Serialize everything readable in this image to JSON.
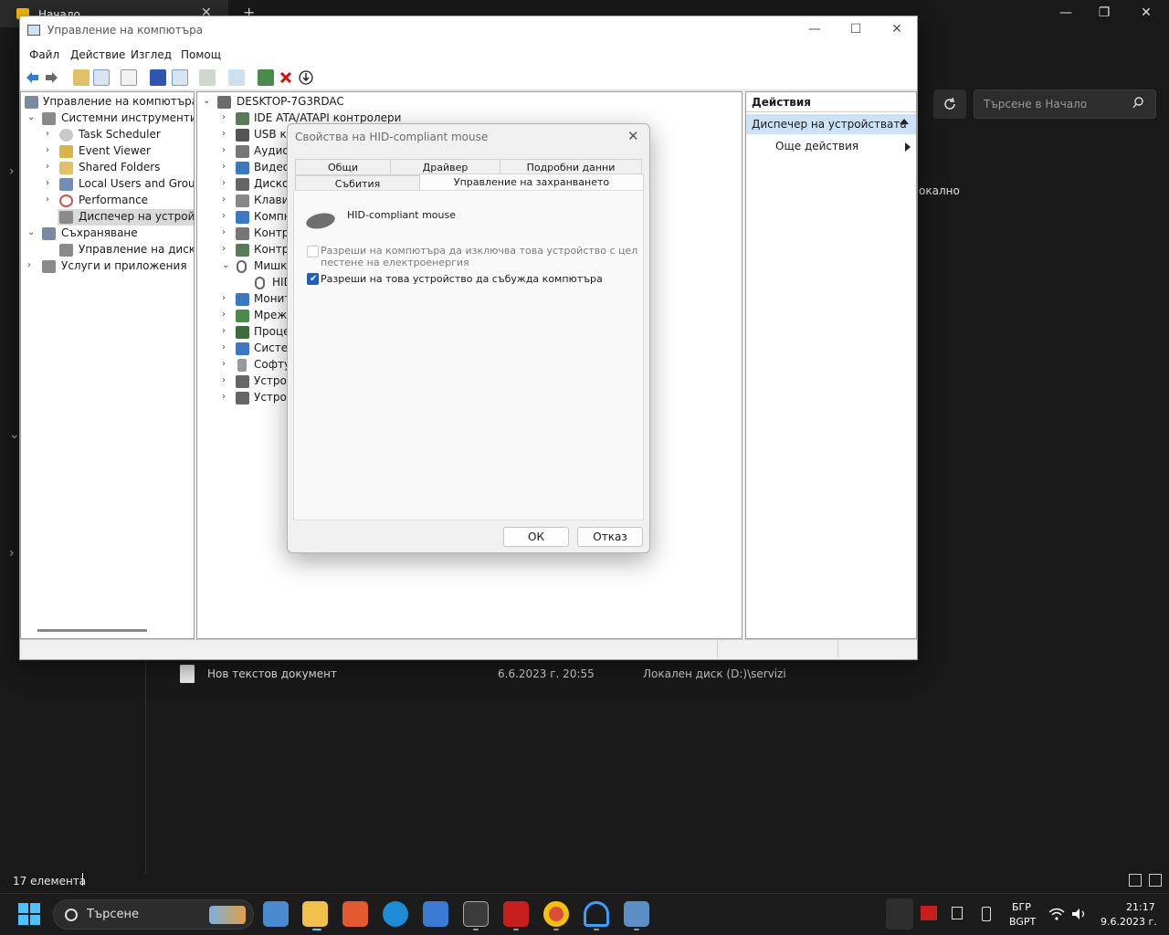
{
  "explorer": {
    "tab_label": "Начало",
    "search_placeholder": "Търсене в Начало",
    "partial_text": "окално",
    "file": {
      "name": "Нов текстов документ",
      "date": "6.6.2023 г. 20:55",
      "path": "Локален диск (D:)\\servizi"
    },
    "status": "17 елемента"
  },
  "cm": {
    "title": "Управление на компютъра",
    "menu": [
      "Файл",
      "Действие",
      "Изглед",
      "Помощ"
    ],
    "left_tree": [
      {
        "label": "Управление на компютъра (л",
        "arrow": "",
        "indent": 0,
        "icon_color": "#7a8aa0"
      },
      {
        "label": "Системни инструменти",
        "arrow": "⌄",
        "indent": 1,
        "icon_color": "#8a8a8a"
      },
      {
        "label": "Task Scheduler",
        "arrow": "›",
        "indent": 2,
        "icon_color": "#c9c9c9"
      },
      {
        "label": "Event Viewer",
        "arrow": "›",
        "indent": 2,
        "icon_color": "#d9b24a"
      },
      {
        "label": "Shared Folders",
        "arrow": "›",
        "indent": 2,
        "icon_color": "#e3c067"
      },
      {
        "label": "Local Users and Groups",
        "arrow": "›",
        "indent": 2,
        "icon_color": "#6f8fb8"
      },
      {
        "label": "Performance",
        "arrow": "›",
        "indent": 2,
        "icon_color": "#d35050"
      },
      {
        "label": "Диспечер на устройства",
        "arrow": "",
        "indent": 2,
        "icon_color": "#8a8a8a",
        "selected": true
      },
      {
        "label": "Съхраняване",
        "arrow": "⌄",
        "indent": 1,
        "icon_color": "#7a8aa0"
      },
      {
        "label": "Управление на дискове",
        "arrow": "",
        "indent": 2,
        "icon_color": "#8a8a8a"
      },
      {
        "label": "Услуги и приложения",
        "arrow": "›",
        "indent": 1,
        "icon_color": "#8a8a8a"
      }
    ],
    "mid_tree": [
      {
        "label": "DESKTOP-7G3RDAC",
        "arrow": "⌄",
        "indent": 0,
        "icon_color": "#6c6c6c"
      },
      {
        "label": "IDE ATA/ATAPI контролери",
        "arrow": "›",
        "indent": 1,
        "icon_color": "#5a7a5a"
      },
      {
        "label": "USB ко",
        "arrow": "›",
        "indent": 1,
        "icon_color": "#555"
      },
      {
        "label": "Аудио",
        "arrow": "›",
        "indent": 1,
        "icon_color": "#777"
      },
      {
        "label": "Видео",
        "arrow": "›",
        "indent": 1,
        "icon_color": "#3b78c4"
      },
      {
        "label": "Диско",
        "arrow": "›",
        "indent": 1,
        "icon_color": "#666"
      },
      {
        "label": "Клави",
        "arrow": "›",
        "indent": 1,
        "icon_color": "#888"
      },
      {
        "label": "Компю",
        "arrow": "›",
        "indent": 1,
        "icon_color": "#3b78c4"
      },
      {
        "label": "Контро",
        "arrow": "›",
        "indent": 1,
        "icon_color": "#777"
      },
      {
        "label": "Контро",
        "arrow": "›",
        "indent": 1,
        "icon_color": "#5a7a5a"
      },
      {
        "label": "Мишк",
        "arrow": "⌄",
        "indent": 1,
        "icon_color": "#666"
      },
      {
        "label": "HID",
        "arrow": "",
        "indent": 2,
        "icon_color": "#666"
      },
      {
        "label": "Монит",
        "arrow": "›",
        "indent": 1,
        "icon_color": "#3b78c4"
      },
      {
        "label": "Мреж",
        "arrow": "›",
        "indent": 1,
        "icon_color": "#4a8a4a"
      },
      {
        "label": "Проце",
        "arrow": "›",
        "indent": 1,
        "icon_color": "#3c6c3c"
      },
      {
        "label": "Систем",
        "arrow": "›",
        "indent": 1,
        "icon_color": "#3b78c4"
      },
      {
        "label": "Софту",
        "arrow": "›",
        "indent": 1,
        "icon_color": "#999"
      },
      {
        "label": "Устрой",
        "arrow": "›",
        "indent": 1,
        "icon_color": "#666"
      },
      {
        "label": "Устрой",
        "arrow": "›",
        "indent": 1,
        "icon_color": "#666"
      }
    ],
    "actions": {
      "title": "Действия",
      "section": "Диспечер на устройствата",
      "more": "Още действия"
    }
  },
  "dialog": {
    "title": "Свойства на HID-compliant mouse",
    "tabs_row1": [
      "Общи",
      "Драйвер",
      "Подробни данни"
    ],
    "tabs_row2": [
      "Събития",
      "Управление на захранването"
    ],
    "device_name": "HID-compliant mouse",
    "option1": "Разреши на компютъра да изключва това устройство с цел пестене на електроенергия",
    "option1_checked": false,
    "option1_enabled": false,
    "option2": "Разреши на това устройство да събужда компютъра",
    "option2_checked": true,
    "ok": "ОК",
    "cancel": "Отказ"
  },
  "taskbar": {
    "search": "Търсене",
    "lang1": "БГР",
    "lang2": "BGPT",
    "time": "21:17",
    "date": "9.6.2023 г.",
    "apps": [
      "widgets-app",
      "file-explorer",
      "cross-app",
      "edge-browser",
      "microsoft-store",
      "xmplay",
      "aida64",
      "chrome-browser",
      "headset-app",
      "control-panel-app"
    ]
  },
  "colors": {
    "accent": "#1e5fbf",
    "selection": "#cce3f7",
    "dark_bg": "#191919"
  }
}
